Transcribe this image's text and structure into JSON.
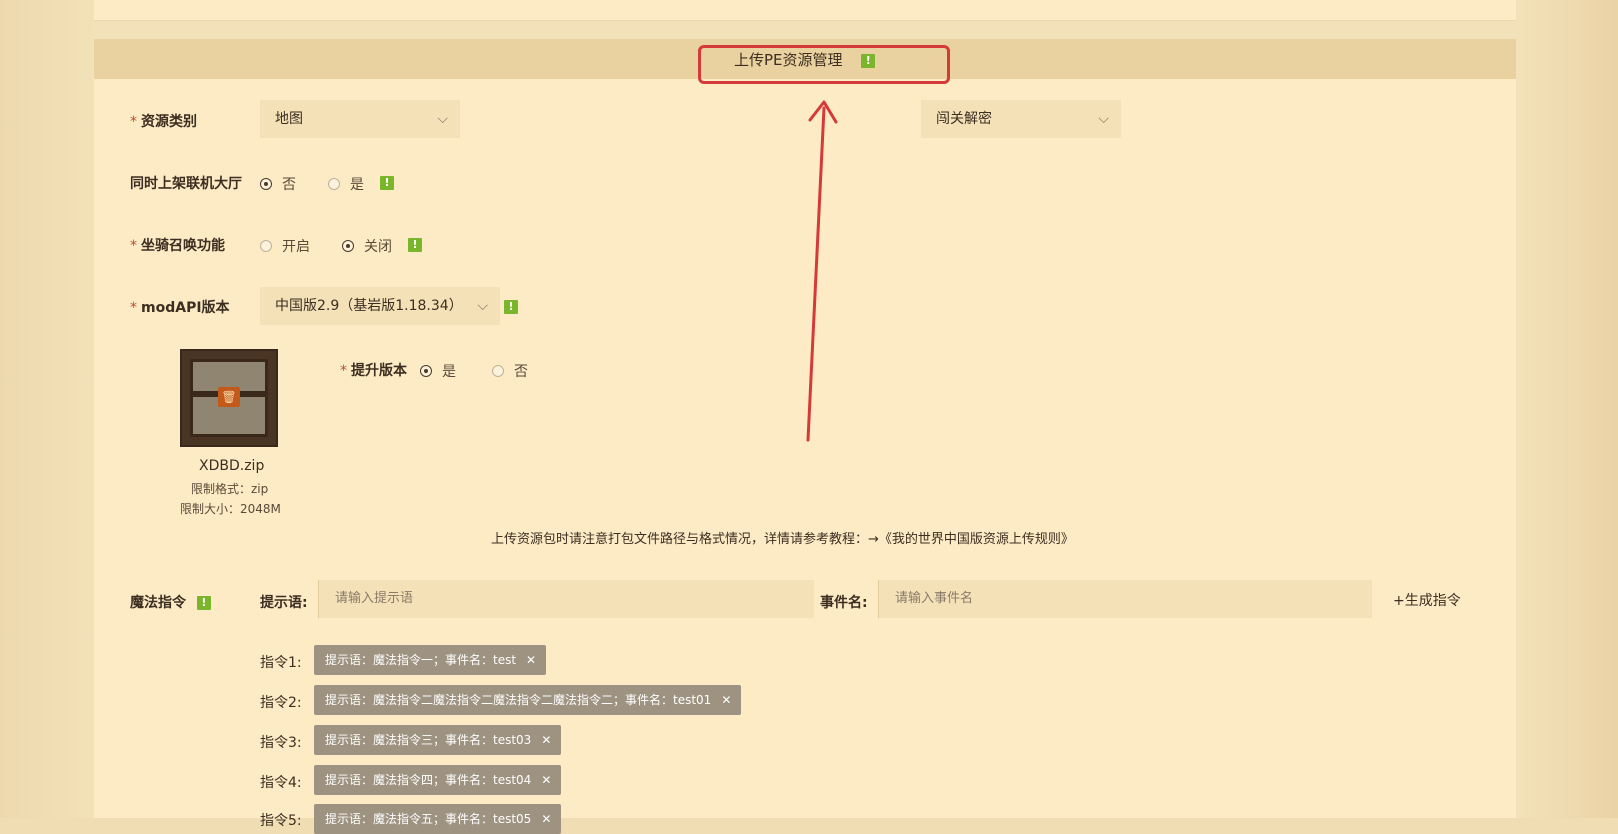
{
  "header": {
    "title": "上传PE资源管理"
  },
  "resource_type": {
    "label": "资源类别",
    "value": "地图",
    "sub_value": "闯关解密"
  },
  "lobby": {
    "label": "同时上架联机大厅",
    "options": [
      "否",
      "是"
    ],
    "selected": "否"
  },
  "mount": {
    "label": "坐骑召唤功能",
    "options": [
      "开启",
      "关闭"
    ],
    "selected": "关闭"
  },
  "mod_api": {
    "label": "modAPI版本",
    "value": "中国版2.9（基岩版1.18.34）"
  },
  "upgrade": {
    "label": "提升版本",
    "options": [
      "是",
      "否"
    ],
    "selected": "是"
  },
  "file": {
    "name": "XDBD.zip",
    "format": "限制格式：zip",
    "size": "限制大小：2048M"
  },
  "note": "上传资源包时请注意打包文件路径与格式情况，详情请参考教程：→《我的世界中国版资源上传规则》",
  "magic": {
    "label": "魔法指令",
    "prompt_label": "提示语:",
    "prompt_placeholder": "请输入提示语",
    "event_label": "事件名:",
    "event_placeholder": "请输入事件名",
    "generate_label": "+生成指令"
  },
  "commands": [
    {
      "label": "指令1:",
      "text": "提示语：魔法指令一；事件名：test"
    },
    {
      "label": "指令2:",
      "text": "提示语：魔法指令二魔法指令二魔法指令二魔法指令二；事件名：test01"
    },
    {
      "label": "指令3:",
      "text": "提示语：魔法指令三；事件名：test03"
    },
    {
      "label": "指令4:",
      "text": "提示语：魔法指令四；事件名：test04"
    },
    {
      "label": "指令5:",
      "text": "提示语：魔法指令五；事件名：test05"
    }
  ],
  "colors": {
    "accent_red": "#d43a3a",
    "warn_green": "#7ab52b",
    "chip_bg": "#9e9280"
  },
  "icons": [
    "chevron-down-icon",
    "warning-icon",
    "trash-icon",
    "close-icon"
  ]
}
